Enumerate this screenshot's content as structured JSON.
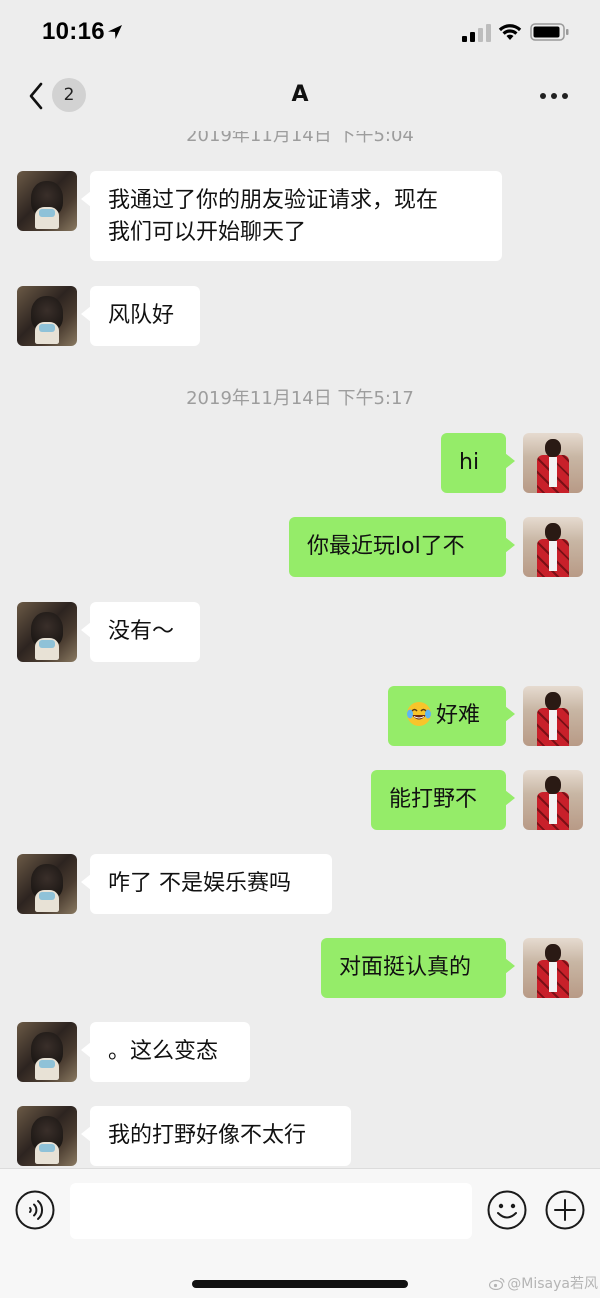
{
  "status_bar": {
    "time": "10:16",
    "icons": [
      "location-arrow-icon",
      "cellular-signal-icon",
      "wifi-icon",
      "battery-icon"
    ]
  },
  "nav": {
    "unread_count": "2",
    "title": "A",
    "icons": [
      "chevron-left-icon",
      "more-dots-icon"
    ]
  },
  "timestamps": [
    "2019年11月14日 下午5:04",
    "2019年11月14日 下午5:17"
  ],
  "messages": [
    {
      "from": "other",
      "text": "我通过了你的朋友验证请求，现在我们可以开始聊天了",
      "lines": [
        "我通过了你的朋友验证请求，现在",
        "我们可以开始聊天了"
      ]
    },
    {
      "from": "other",
      "text": "风队好"
    },
    {
      "from": "me",
      "text": "hi"
    },
    {
      "from": "me",
      "text": "你最近玩lol了不"
    },
    {
      "from": "other",
      "text": "没有～"
    },
    {
      "from": "me",
      "emoji": "tears-of-joy-emoji",
      "text": "好难"
    },
    {
      "from": "me",
      "text": "能打野不"
    },
    {
      "from": "other",
      "text": "咋了 不是娱乐赛吗"
    },
    {
      "from": "me",
      "text": "对面挺认真的"
    },
    {
      "from": "other",
      "text": "。这么变态"
    },
    {
      "from": "other",
      "text": "我的打野好像不太行"
    }
  ],
  "input_bar": {
    "message_value": "",
    "icons": [
      "voice-icon",
      "emoji-icon",
      "plus-icon"
    ]
  },
  "watermark": "@Misaya若风",
  "colors": {
    "background": "#ededed",
    "incoming_bubble": "#ffffff",
    "outgoing_bubble": "#95ec69",
    "timestamp_text": "#9d9d9d"
  }
}
